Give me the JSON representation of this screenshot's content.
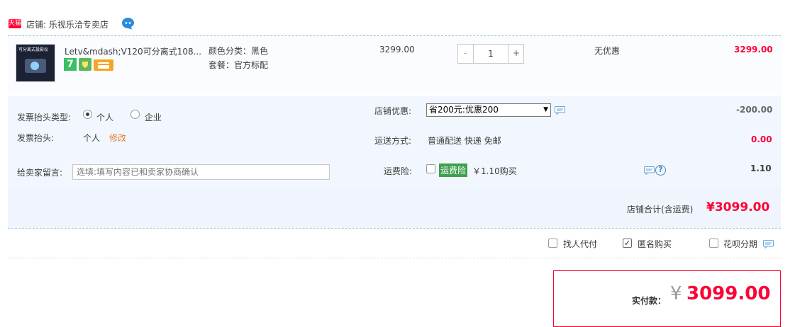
{
  "shop": {
    "badge_text": "天猫",
    "name": "店铺: 乐视乐洽专卖店"
  },
  "item": {
    "thumb_caption": "可分离式投影仪",
    "title": "Letv&mdash;V120可分离式108...",
    "badge_7": "7",
    "sku_color": "颜色分类：黑色",
    "sku_package": "套餐：官方标配",
    "unit_price": "3299.00",
    "quantity": "1",
    "qty_minus": "-",
    "qty_plus": "+",
    "discount": "无优惠",
    "total": "3299.00"
  },
  "invoice": {
    "type_label": "发票抬头类型:",
    "option_personal": "个人",
    "option_company": "企业",
    "title_label": "发票抬头:",
    "title_value": "个人",
    "edit_link": "修改"
  },
  "message": {
    "label": "给卖家留言:",
    "placeholder": "选填:填写内容已和卖家协商确认"
  },
  "shop_discount": {
    "label": "店铺优惠:",
    "selected": "省200元:优惠200",
    "amount": "-200.00"
  },
  "shipping": {
    "label": "运送方式:",
    "value": "普通配送 快递 免邮",
    "amount": "0.00"
  },
  "insurance": {
    "label": "运费险:",
    "tag": "运费险",
    "text": "￥1.10购买",
    "help": "?",
    "amount": "1.10"
  },
  "shop_total": {
    "label": "店铺合计(含运费)",
    "value": "¥3099.00"
  },
  "options": {
    "proxy_pay": "找人代付",
    "anonymous": "匿名购买",
    "huabei": "花呗分期"
  },
  "payment": {
    "label": "实付款：",
    "currency": "¥",
    "amount": "3099.00"
  },
  "colors": {
    "accent_red": "#ff0036",
    "row_bg": "#f2f7ff",
    "edit_orange": "#e6792f",
    "insurance_green": "#3ea050"
  }
}
